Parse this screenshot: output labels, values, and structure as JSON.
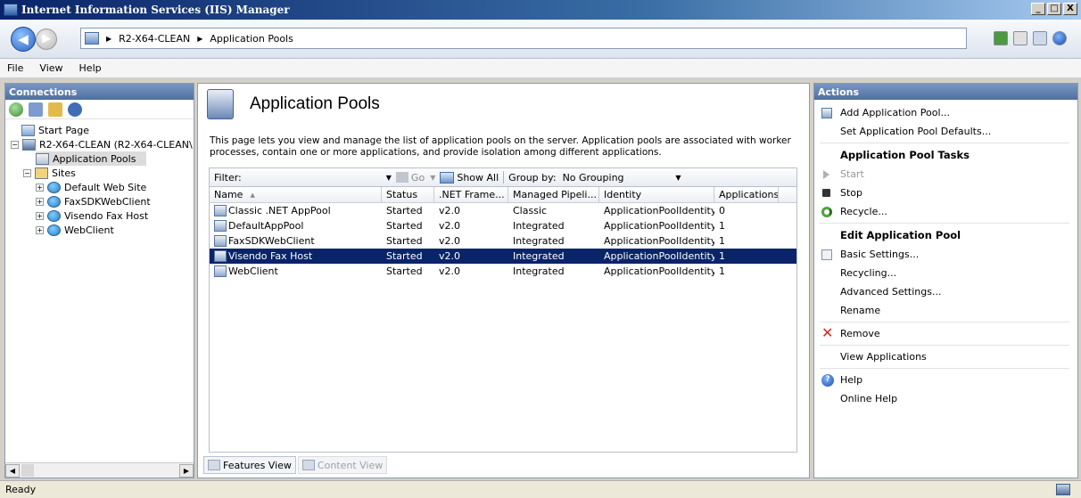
{
  "window": {
    "title": "Internet Information Services (IIS) Manager",
    "minimize": "_",
    "restore": "□",
    "close": "X"
  },
  "address": {
    "back_glyph": "◀",
    "forward_glyph": "▶",
    "crumbs": [
      "R2-X64-CLEAN",
      "Application Pools"
    ],
    "separator": "▶"
  },
  "menu": [
    "File",
    "View",
    "Help"
  ],
  "connections": {
    "title": "Connections",
    "tree": {
      "start_page": "Start Page",
      "server": "R2-X64-CLEAN (R2-X64-CLEAN\\",
      "app_pools": "Application Pools",
      "sites": "Sites",
      "site_items": [
        "Default Web Site",
        "FaxSDKWebClient",
        "Visendo Fax Host",
        "WebClient"
      ]
    },
    "scroll_left": "◀",
    "scroll_right": "▶"
  },
  "center": {
    "title": "Application Pools",
    "description": "This page lets you view and manage the list of application pools on the server. Application pools are associated with worker processes, contain one or more applications, and provide isolation among different applications.",
    "filter_label": "Filter:",
    "go_label": "Go",
    "show_all_label": "Show All",
    "group_by_label": "Group by:",
    "group_by_value": "No Grouping",
    "columns": [
      "Name",
      "Status",
      ".NET Frame...",
      "Managed Pipeli...",
      "Identity",
      "Applications"
    ],
    "sort_glyph": "▲",
    "rows": [
      {
        "name": "Classic .NET AppPool",
        "status": "Started",
        "net": "v2.0",
        "pipeline": "Classic",
        "identity": "ApplicationPoolIdentity",
        "apps": "0"
      },
      {
        "name": "DefaultAppPool",
        "status": "Started",
        "net": "v2.0",
        "pipeline": "Integrated",
        "identity": "ApplicationPoolIdentity",
        "apps": "1"
      },
      {
        "name": "FaxSDKWebClient",
        "status": "Started",
        "net": "v2.0",
        "pipeline": "Integrated",
        "identity": "ApplicationPoolIdentity",
        "apps": "1"
      },
      {
        "name": "Visendo Fax Host",
        "status": "Started",
        "net": "v2.0",
        "pipeline": "Integrated",
        "identity": "ApplicationPoolIdentity",
        "apps": "1"
      },
      {
        "name": "WebClient",
        "status": "Started",
        "net": "v2.0",
        "pipeline": "Integrated",
        "identity": "ApplicationPoolIdentity",
        "apps": "1"
      }
    ],
    "features_view": "Features View",
    "content_view": "Content View"
  },
  "actions": {
    "title": "Actions",
    "add_pool": "Add Application Pool...",
    "set_defaults": "Set Application Pool Defaults...",
    "tasks_header": "Application Pool Tasks",
    "start": "Start",
    "stop": "Stop",
    "recycle": "Recycle...",
    "edit_header": "Edit Application Pool",
    "basic_settings": "Basic Settings...",
    "recycling": "Recycling...",
    "advanced_settings": "Advanced Settings...",
    "rename": "Rename",
    "remove": "Remove",
    "remove_glyph": "✕",
    "view_apps": "View Applications",
    "help": "Help",
    "help_glyph": "?",
    "online_help": "Online Help"
  },
  "status": {
    "text": "Ready"
  },
  "colors": {
    "selection": "#0a246a",
    "panel_header": "#4f6f9f",
    "remove_red": "#d32a1f"
  }
}
